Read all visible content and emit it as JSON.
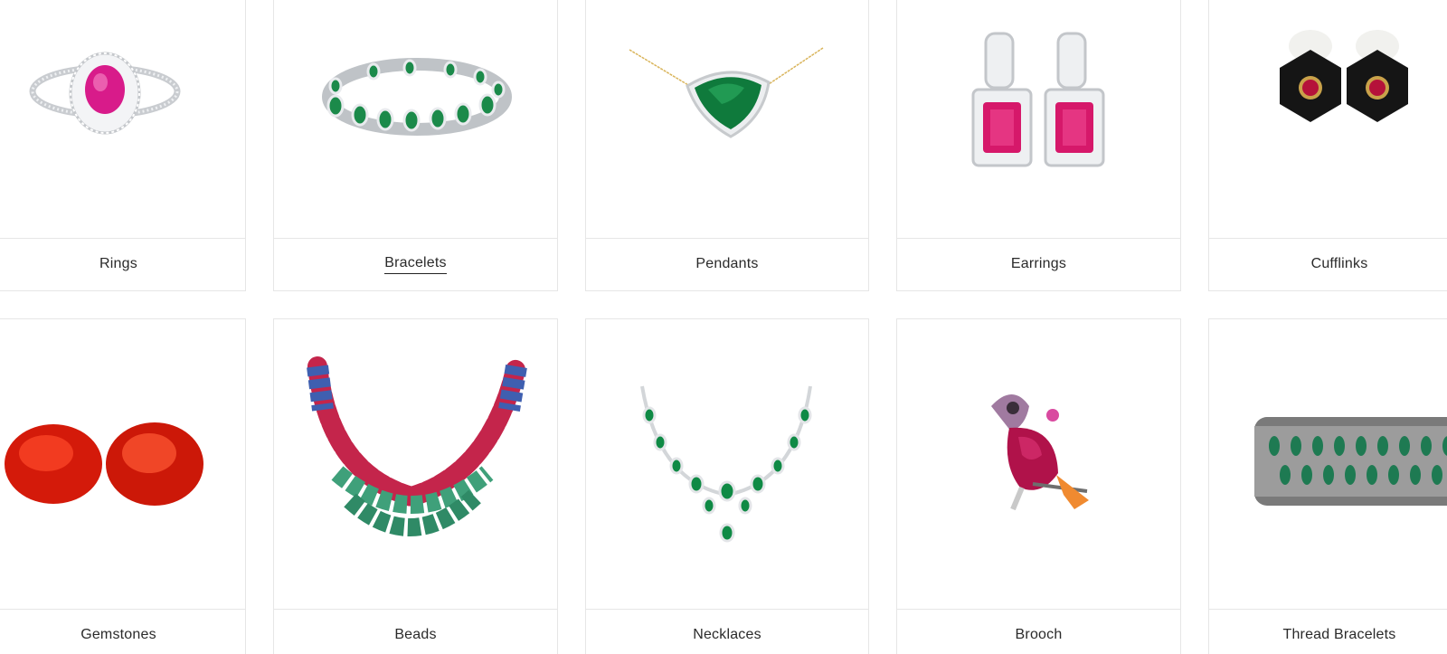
{
  "categories": [
    {
      "label": "Rings",
      "icon": "ring-image"
    },
    {
      "label": "Bracelets",
      "icon": "bracelet-image"
    },
    {
      "label": "Pendants",
      "icon": "pendant-image"
    },
    {
      "label": "Earrings",
      "icon": "earrings-image"
    },
    {
      "label": "Cufflinks",
      "icon": "cufflinks-image"
    },
    {
      "label": "Gemstones",
      "icon": "gemstones-image"
    },
    {
      "label": "Beads",
      "icon": "beads-image"
    },
    {
      "label": "Necklaces",
      "icon": "necklace-image"
    },
    {
      "label": "Brooch",
      "icon": "brooch-image"
    },
    {
      "label": "Thread Bracelets",
      "icon": "thread-bracelet-image"
    }
  ],
  "active_category": "Bracelets",
  "colors": {
    "border": "#e6e6e6",
    "text": "#2a2a2a",
    "ruby": "#d81b60",
    "emerald": "#1b8a4a",
    "sapphire": "#3f5fb0",
    "onyx": "#151515"
  }
}
